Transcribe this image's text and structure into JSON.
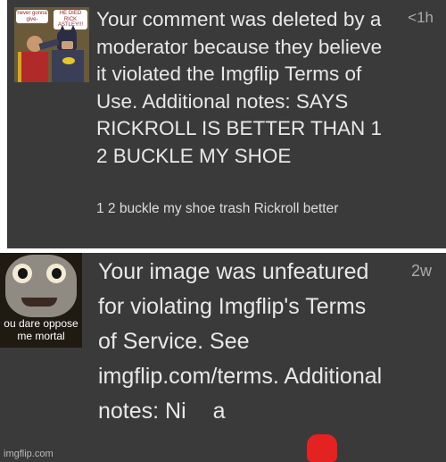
{
  "notifications": [
    {
      "message": "Your comment was deleted by a moderator because they believe it violated the Imgflip Terms of Use. Additional notes: SAYS RICKROLL IS BETTER THAN 1 2 BUCKLE MY SHOE",
      "comment": "1 2 buckle my shoe trash Rickroll better",
      "time": "<1h",
      "thumbnail": {
        "bubble_left": "never gonna give-",
        "bubble_right": "HE DIED RICK ASTLEY!!!",
        "icon": "batman-slapping-robin-meme"
      }
    },
    {
      "message": "Your image was unfeatured for violating Imgflip's Terms of Service. See imgflip.com/terms. Additional notes: Ni",
      "message_tail": "a",
      "time": "2w",
      "thumbnail": {
        "caption": "ou dare oppose me mortal",
        "icon": "thomas-tank-engine-face"
      }
    }
  ],
  "watermark": "imgflip.com",
  "colors": {
    "panel_bg": "#3a3a3a",
    "text": "#e8e8e8",
    "time": "#aaaaaa",
    "redaction": "#e52222"
  }
}
